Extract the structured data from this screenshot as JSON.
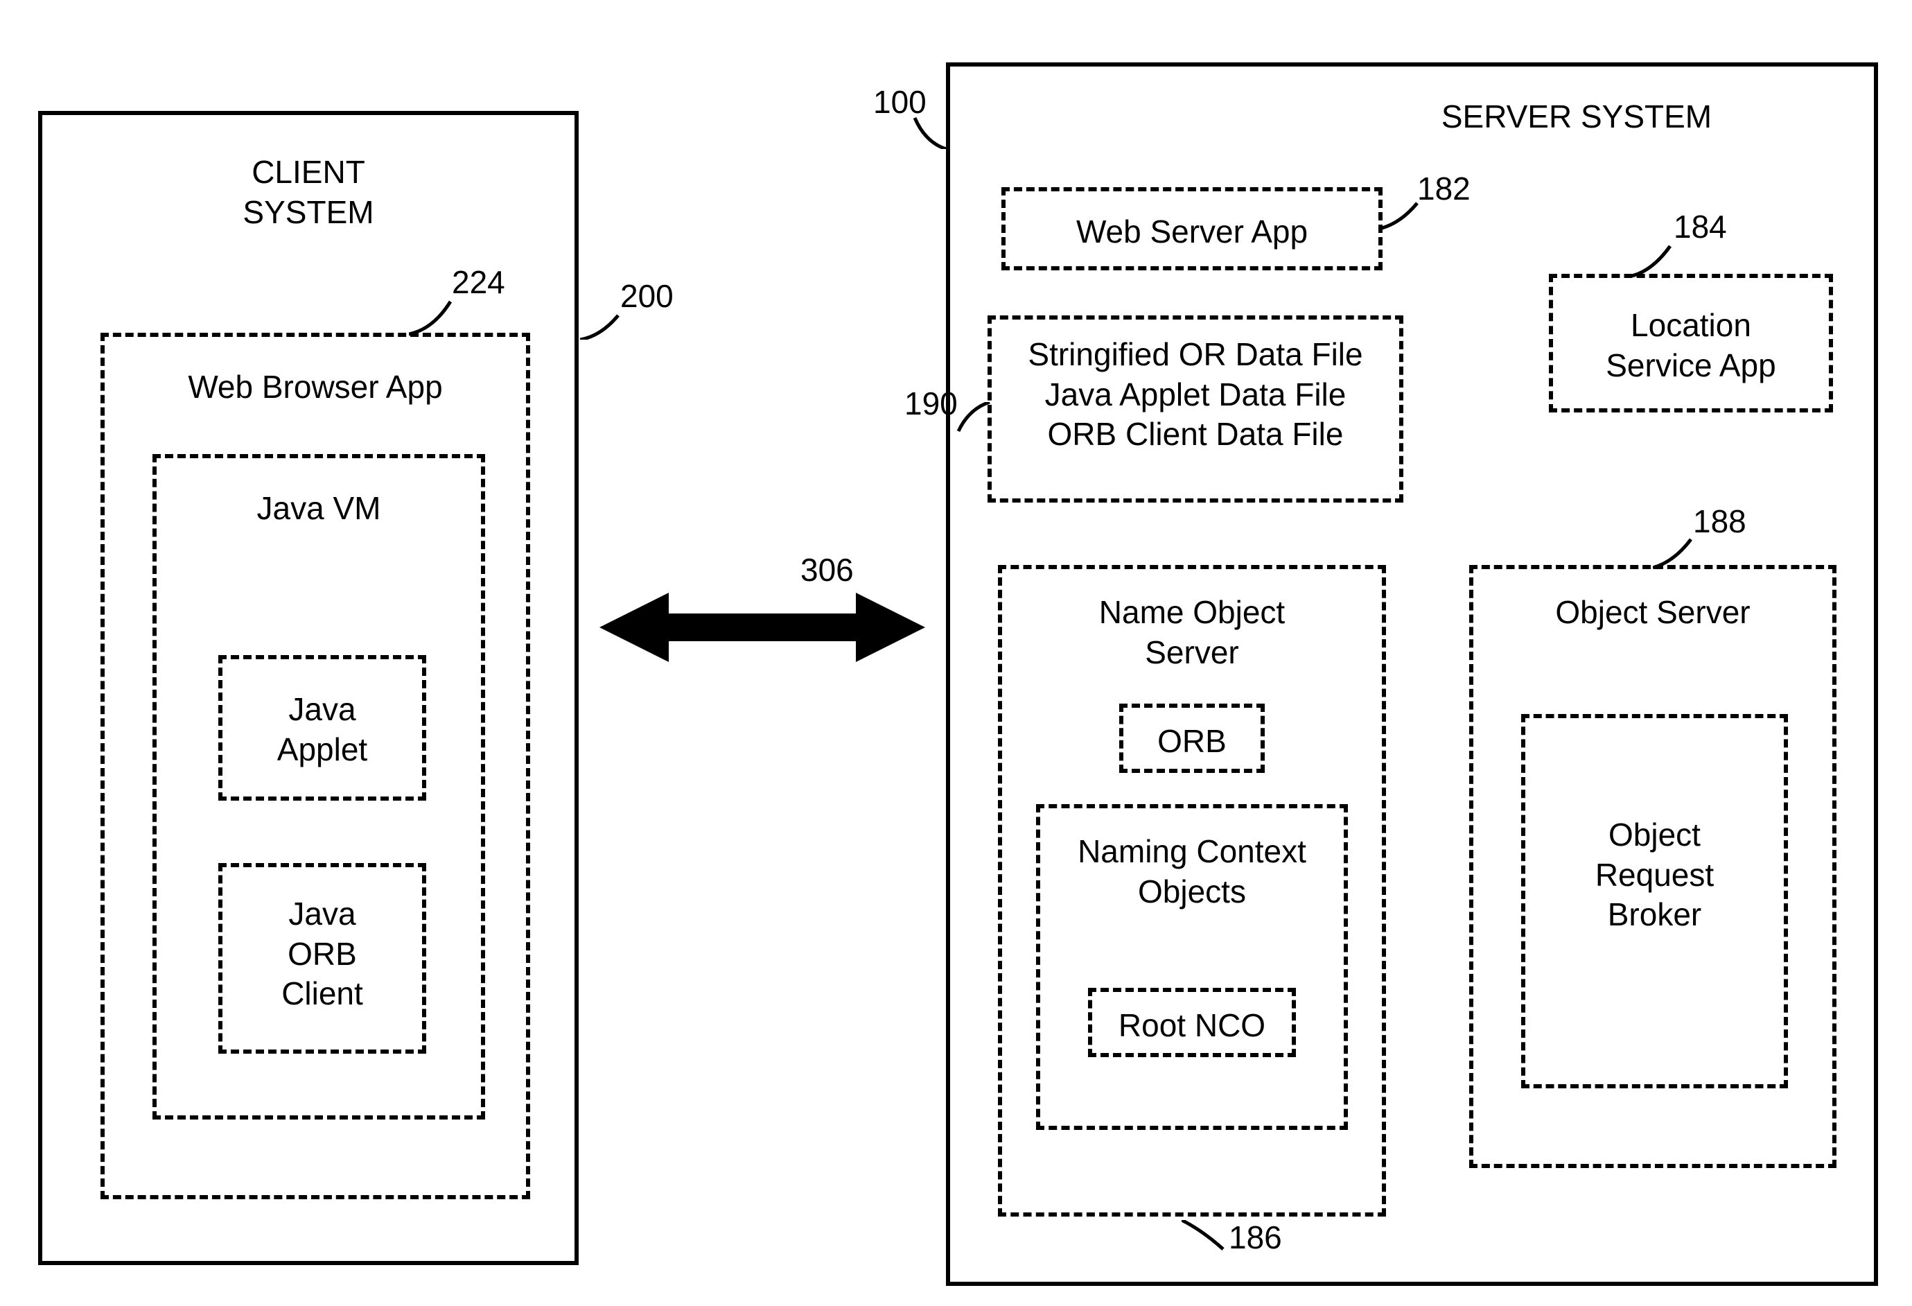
{
  "client": {
    "title": "CLIENT\nSYSTEM",
    "ref_box": "200",
    "browser": {
      "label": "Web Browser App",
      "ref": "224",
      "javaVm": {
        "label": "Java VM"
      },
      "javaApplet": {
        "label": "Java\nApplet"
      },
      "javaOrbClient": {
        "label": "Java\nORB\nClient"
      }
    }
  },
  "server": {
    "title": "SERVER SYSTEM",
    "ref_box": "100",
    "webServerApp": {
      "label": "Web Server App",
      "ref": "182"
    },
    "locationServiceApp": {
      "label": "Location\nService App",
      "ref": "184"
    },
    "dataFiles": {
      "ref": "190",
      "line1": "Stringified OR Data File",
      "line2": "Java Applet Data File",
      "line3": "ORB Client Data File"
    },
    "nameObjectServer": {
      "label": "Name Object\nServer",
      "ref": "186",
      "orb": {
        "label": "ORB"
      },
      "namingContextObjects": {
        "label": "Naming Context\nObjects"
      },
      "rootNco": {
        "label": "Root NCO"
      }
    },
    "objectServer": {
      "label": "Object Server",
      "ref": "188",
      "orb": {
        "label": "Object\nRequest\nBroker"
      }
    }
  },
  "arrow": {
    "ref": "306"
  }
}
